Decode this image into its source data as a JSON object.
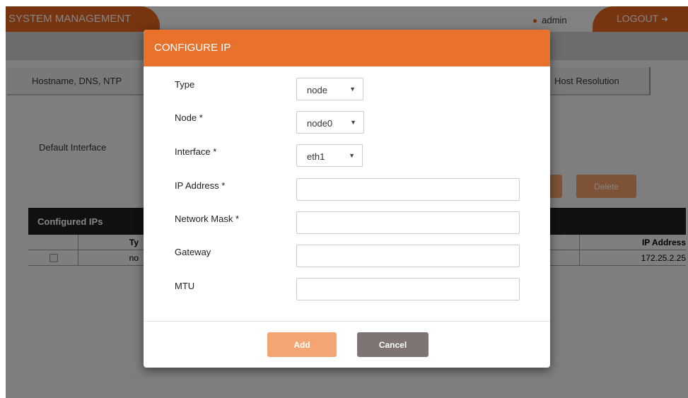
{
  "header": {
    "title": "SYSTEM MANAGEMENT",
    "user": "admin",
    "logout_label": "LOGOUT"
  },
  "tabs": {
    "hostname": "Hostname, DNS, NTP",
    "host_resolution": "Host Resolution"
  },
  "background": {
    "default_interface_label": "Default Interface",
    "delete_label": "Delete",
    "configured_ips_title": "Configured IPs",
    "columns": [
      "Ty",
      "IP Address"
    ],
    "rows": [
      {
        "type": "no",
        "ip": "172.25.2.25"
      }
    ]
  },
  "modal": {
    "title": "CONFIGURE IP",
    "fields": {
      "type_label": "Type",
      "type_value": "node",
      "node_label": "Node *",
      "node_value": "node0",
      "interface_label": "Interface *",
      "interface_value": "eth1",
      "ip_label": "IP Address *",
      "ip_value": "",
      "mask_label": "Network Mask *",
      "mask_value": "",
      "gateway_label": "Gateway",
      "gateway_value": "",
      "mtu_label": "MTU",
      "mtu_value": ""
    },
    "add_label": "Add",
    "cancel_label": "Cancel"
  },
  "icons": {
    "user": "user-icon",
    "logout": "logout-icon",
    "caret": "caret-down-icon"
  },
  "colors": {
    "accent": "#e26420",
    "modal_header": "#e8712b",
    "add_button": "#f4a574",
    "cancel_button": "#7d7473"
  }
}
